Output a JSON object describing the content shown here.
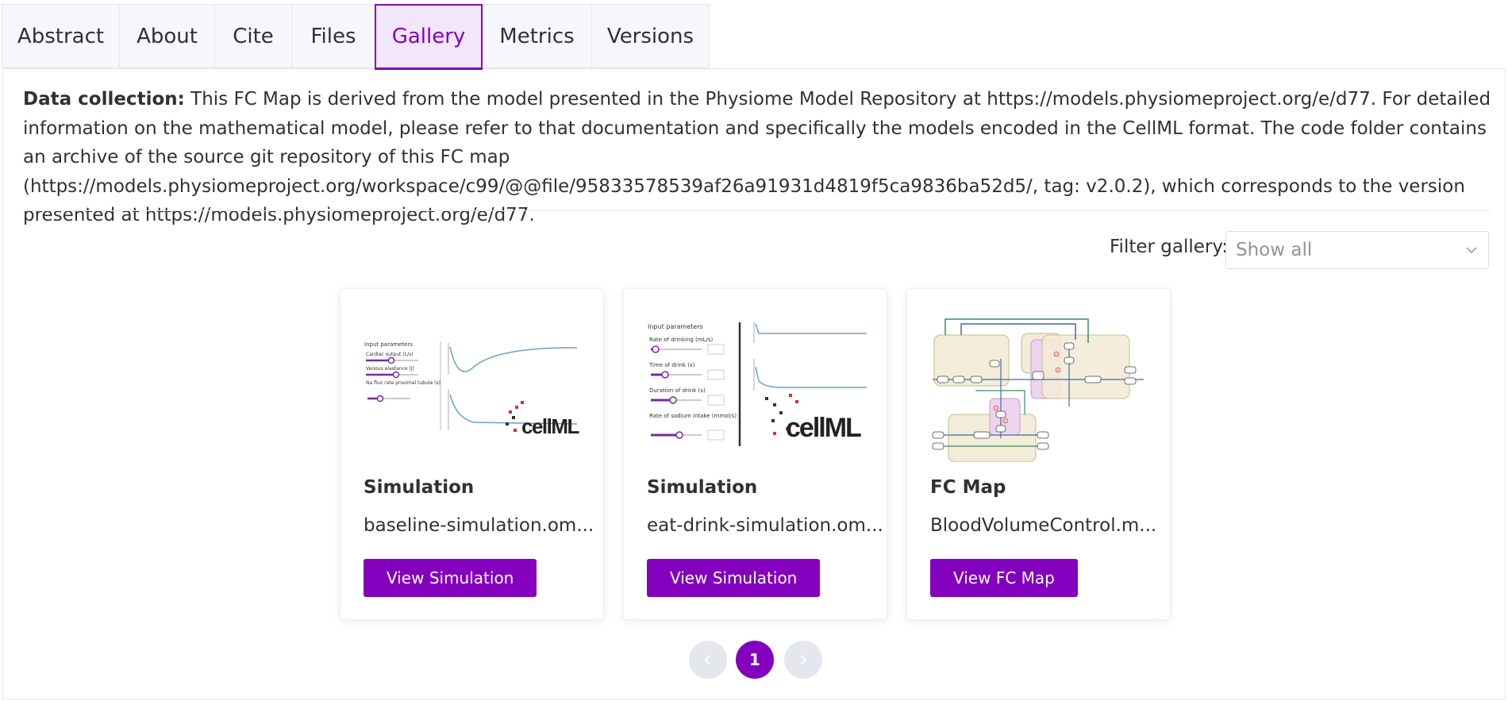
{
  "tabs": [
    {
      "label": "Abstract"
    },
    {
      "label": "About"
    },
    {
      "label": "Cite"
    },
    {
      "label": "Files"
    },
    {
      "label": "Gallery",
      "active": true
    },
    {
      "label": "Metrics"
    },
    {
      "label": "Versions"
    }
  ],
  "description": {
    "heading": "Data collection:",
    "text": "This FC Map is derived from the model presented in the Physiome Model Repository at https://models.physiomeproject.org/e/d77. For detailed information on the mathematical model, please refer to that documentation and specifically the models encoded in the CellML format. The code folder contains an archive of the source git repository of this FC map (https://models.physiomeproject.org/workspace/c99/@@file/95833578539af26a91931d4819f5ca9836ba52d5/, tag: v2.0.2), which corresponds to the version presented at https://models.physiomeproject.org/e/d77."
  },
  "filter": {
    "label": "Filter gallery:",
    "placeholder": "Show all"
  },
  "cards": [
    {
      "type": "Simulation",
      "file": "baseline-simulation.om...",
      "button": "View Simulation",
      "thumb_icon": "simulation-cellml-thumbnail"
    },
    {
      "type": "Simulation",
      "file": "eat-drink-simulation.om...",
      "button": "View Simulation",
      "thumb_icon": "simulation-cellml-thumbnail"
    },
    {
      "type": "FC Map",
      "file": "BloodVolumeControl.m...",
      "button": "View FC Map",
      "thumb_icon": "fc-map-thumbnail"
    }
  ],
  "thumb_text": {
    "input_params": "Input parameters",
    "cellml": "cellML",
    "card0": [
      "Cardiac output (L/s)",
      "Venous elastance (J)",
      "Na flux rate proximal tubule (s)"
    ],
    "card1": [
      "Rate of drinking (mL/s)",
      "Time of drink (s)",
      "Duration of drink (s)",
      "Rate of sodium intake (mmol/s)"
    ]
  },
  "pagination": {
    "current": "1"
  },
  "colors": {
    "accent": "#8300bf",
    "tab_active_bg": "#f2e6fa",
    "border": "#e4e7ed"
  }
}
